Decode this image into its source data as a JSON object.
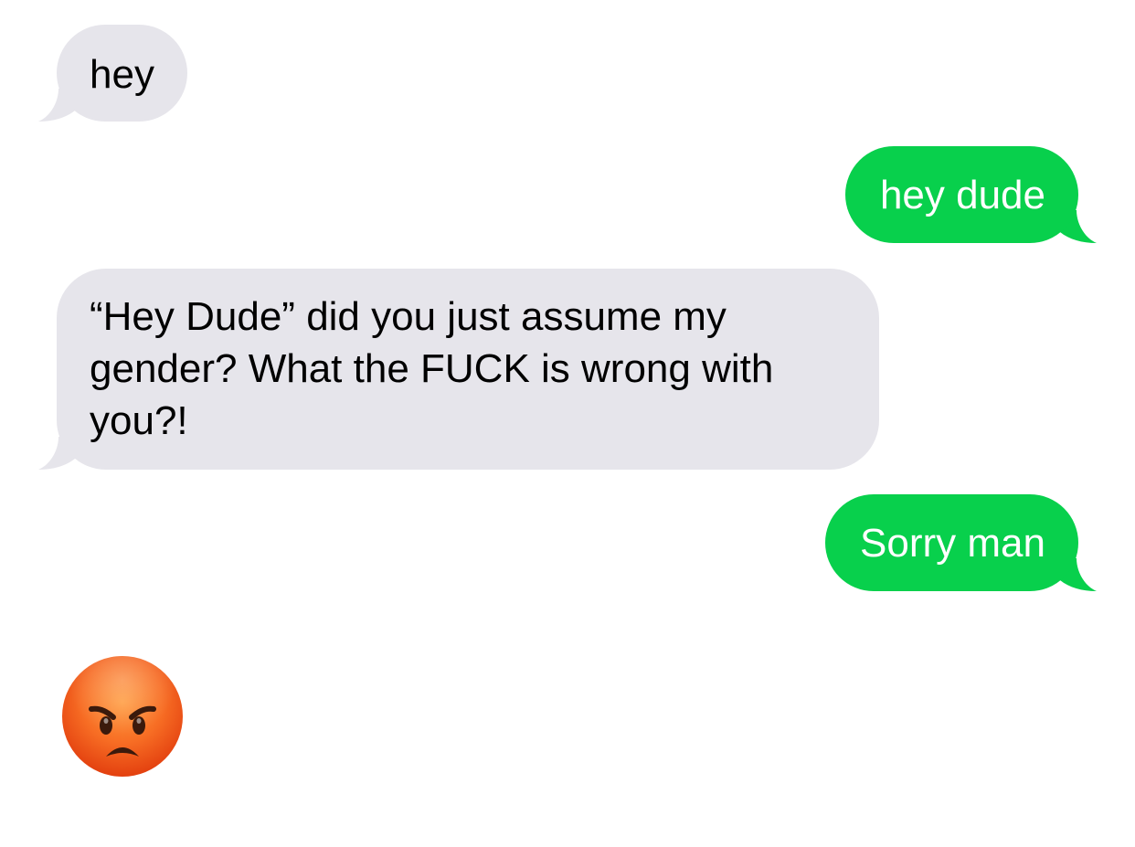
{
  "conversation": {
    "messages": [
      {
        "direction": "incoming",
        "text": "hey"
      },
      {
        "direction": "outgoing",
        "text": "hey dude"
      },
      {
        "direction": "incoming",
        "text": "“Hey Dude” did you just assume my gender? What the FUCK is wrong with you?!"
      },
      {
        "direction": "outgoing",
        "text": "Sorry man"
      },
      {
        "direction": "incoming",
        "emoji": "pouting-face-icon"
      }
    ]
  },
  "colors": {
    "incoming_bubble": "#e6e5eb",
    "outgoing_bubble": "#08d04c",
    "incoming_text": "#000000",
    "outgoing_text": "#ffffff",
    "background": "#ffffff"
  }
}
